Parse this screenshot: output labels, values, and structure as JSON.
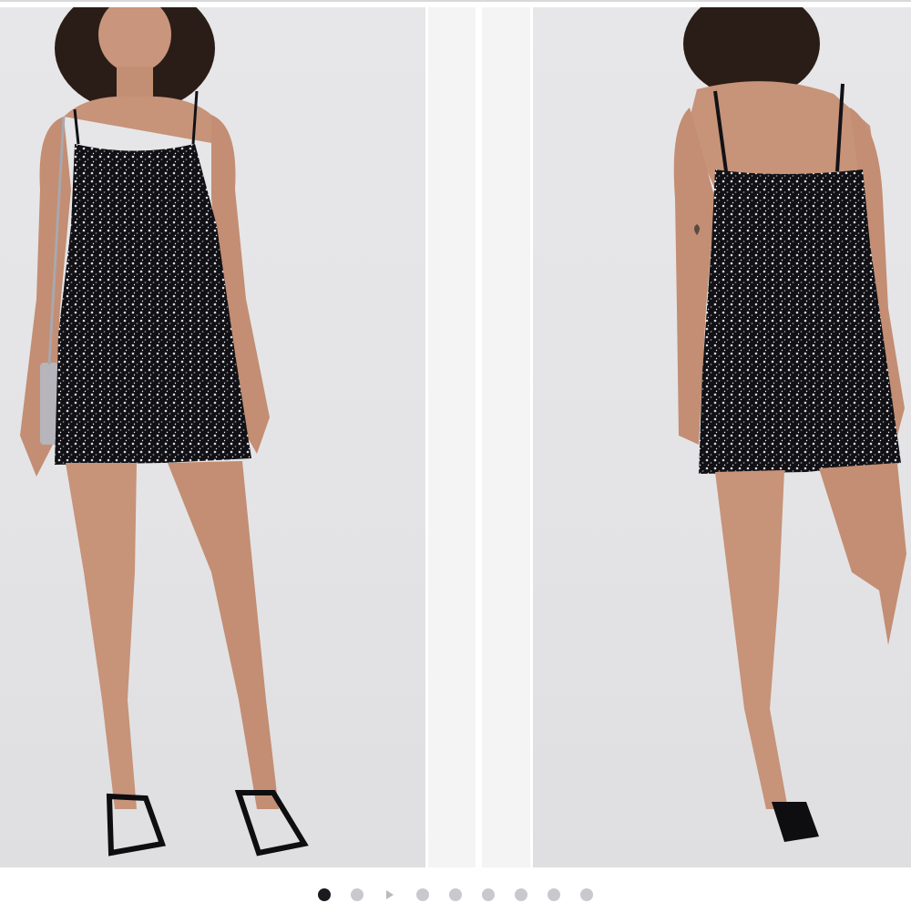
{
  "gallery": {
    "slide_count": 9,
    "active_index": 0,
    "images": [
      {
        "view": "front"
      },
      {
        "view": "back"
      }
    ]
  },
  "colors": {
    "backdrop": "#e6e6e8",
    "dress": "#121216",
    "dot_active": "#1b1b1f",
    "dot_inactive": "#c9c9cd"
  }
}
